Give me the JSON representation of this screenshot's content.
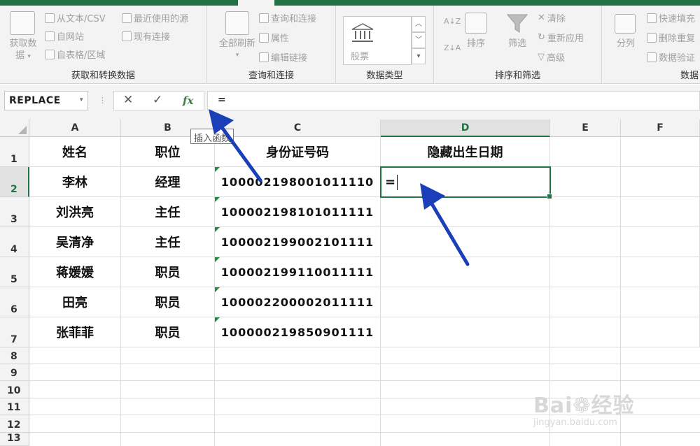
{
  "ribbon": {
    "get_transform": {
      "big_label_1": "获取数",
      "big_label_2": "据",
      "from_text_csv": "从文本/CSV",
      "from_web": "自网站",
      "from_table": "自表格/区域",
      "recent_sources": "最近使用的源",
      "existing_conn": "现有连接",
      "group_label": "获取和转换数据"
    },
    "queries": {
      "refresh_all": "全部刷新",
      "queries_conn": "查询和连接",
      "properties": "属性",
      "edit_links": "编辑链接",
      "group_label": "查询和连接"
    },
    "data_types": {
      "stocks": "股票",
      "group_label": "数据类型"
    },
    "sort_filter": {
      "sort": "排序",
      "filter": "筛选",
      "clear": "清除",
      "reapply": "重新应用",
      "advanced": "高级",
      "group_label": "排序和筛选"
    },
    "data_tools": {
      "split": "分列",
      "flash_fill": "快速填充",
      "remove_dup": "删除重复",
      "validation": "数据验证",
      "group_label_partial": "数据"
    }
  },
  "formula_bar": {
    "name_box": "REPLACE",
    "cancel": "✕",
    "enter": "✓",
    "fx": "fx",
    "formula": "=",
    "tooltip": "插入函数"
  },
  "columns": [
    "A",
    "B",
    "C",
    "D",
    "E",
    "F"
  ],
  "rows": [
    "1",
    "2",
    "3",
    "4",
    "5",
    "6",
    "7",
    "8",
    "9",
    "10",
    "11",
    "12",
    "13"
  ],
  "cells": {
    "header": [
      "姓名",
      "职位",
      "身份证号码",
      "隐藏出生日期"
    ],
    "data": [
      [
        "李林",
        "经理",
        "100002198001011110"
      ],
      [
        "刘洪亮",
        "主任",
        "100002198101011111"
      ],
      [
        "吴清净",
        "主任",
        "100002199002101111"
      ],
      [
        "蒋媛媛",
        "职员",
        "100002199110011111"
      ],
      [
        "田亮",
        "职员",
        "100002200002011111"
      ],
      [
        "张菲菲",
        "职员",
        "100000219850901111"
      ]
    ],
    "active_cell_value": "="
  },
  "watermark": {
    "brand": "Bai",
    "brand_tail": "经验",
    "url": "jingyan.baidu.com"
  },
  "colors": {
    "excel_green": "#217346",
    "arrow_blue": "#1a3fb8"
  }
}
